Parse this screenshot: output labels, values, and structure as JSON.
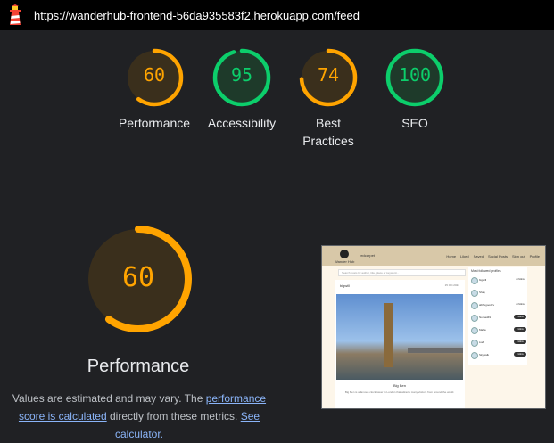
{
  "topbar": {
    "url": "https://wanderhub-frontend-56da935583f2.herokuapp.com/feed"
  },
  "colors": {
    "average": "#ffa400",
    "pass": "#0cce6b",
    "average_bg": "#3a2f1c",
    "pass_bg": "#1e3a2a"
  },
  "scores": [
    {
      "label": "Performance",
      "value": 60,
      "status": "average"
    },
    {
      "label": "Accessibility",
      "value": 95,
      "status": "pass"
    },
    {
      "label": "Best\nPractices",
      "value": 74,
      "status": "average"
    },
    {
      "label": "SEO",
      "value": 100,
      "status": "pass"
    }
  ],
  "main": {
    "value": 60,
    "title": "Performance",
    "note_prefix": "Values are estimated and may vary. The ",
    "note_link1": "performance score is calculated",
    "note_mid": " directly from these metrics. ",
    "note_link2": "See calculator."
  },
  "thumbnail": {
    "brand": "Wander Hub",
    "user": "redcarpet",
    "nav": [
      "Home",
      "Liked",
      "Saved",
      "Social Posts",
      "Sign out",
      "Profile"
    ],
    "search_placeholder": "Search posts by author, title, place or keyword...",
    "post_user": "bigwill",
    "post_date": "15 Oct 2024",
    "post_title": "Big Ben",
    "post_desc": "Big Ben is a famous clock tower in London that attracts many visitors from around the world.",
    "side_title": "Most followed profiles",
    "profiles": [
      {
        "name": "bigwill",
        "btn": "unfollow"
      },
      {
        "name": "Shay",
        "btn": ""
      },
      {
        "name": "allthegoodtrv",
        "btn": "unfollow"
      },
      {
        "name": "Nomad49",
        "btn": "Follow"
      },
      {
        "name": "Maha",
        "btn": "Follow"
      },
      {
        "name": "Lia8",
        "btn": "Follow"
      },
      {
        "name": "Skywalk",
        "btn": "Follow"
      }
    ]
  }
}
